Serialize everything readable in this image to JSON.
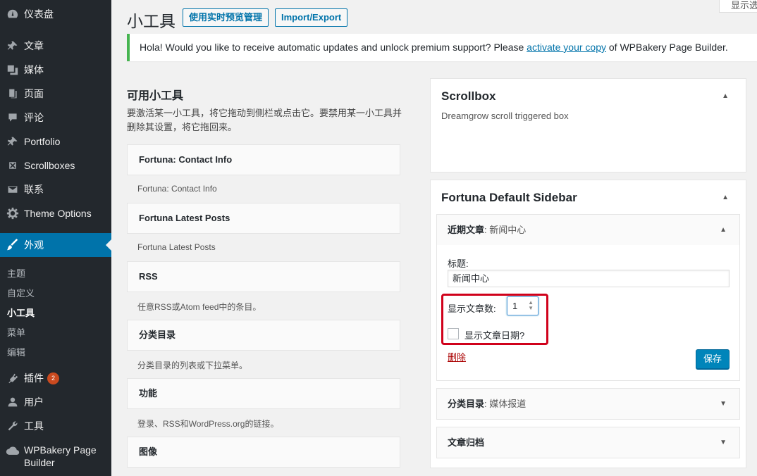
{
  "sidebar": {
    "items": [
      {
        "label": "仪表盘",
        "icon": "dashboard-icon"
      },
      {
        "label": "文章",
        "icon": "pin-icon"
      },
      {
        "label": "媒体",
        "icon": "media-icon"
      },
      {
        "label": "页面",
        "icon": "page-icon"
      },
      {
        "label": "评论",
        "icon": "comment-icon"
      },
      {
        "label": "Portfolio",
        "icon": "pin-icon"
      },
      {
        "label": "Scrollboxes",
        "icon": "box-icon"
      },
      {
        "label": "联系",
        "icon": "mail-icon"
      },
      {
        "label": "Theme Options",
        "icon": "gear-icon"
      },
      {
        "label": "外观",
        "icon": "brush-icon"
      }
    ],
    "submenu": [
      "主题",
      "自定义",
      "小工具",
      "菜单",
      "编辑"
    ],
    "bottom_items": [
      {
        "label": "插件",
        "icon": "plugin-icon",
        "badge": "2"
      },
      {
        "label": "用户",
        "icon": "user-icon"
      },
      {
        "label": "工具",
        "icon": "wrench-icon"
      },
      {
        "label": "WPBakery Page Builder",
        "icon": "cloud-icon"
      }
    ]
  },
  "header": {
    "title": "小工具",
    "live_preview_btn": "使用实时预览管理",
    "import_export_btn": "Import/Export",
    "screen_options": "显示选项"
  },
  "notice": {
    "text_before": "Hola! Would you like to receive automatic updates and unlock premium support? Please ",
    "link": "activate your copy",
    "text_after": " of WPBakery Page Builder."
  },
  "available": {
    "title": "可用小工具",
    "desc": "要激活某一小工具，将它拖动到侧栏或点击它。要禁用某一小工具并删除其设置，将它拖回来。",
    "widgets": [
      {
        "name": "Fortuna: Contact Info",
        "desc": "Fortuna: Contact Info"
      },
      {
        "name": "Fortuna Latest Posts",
        "desc": "Fortuna Latest Posts"
      },
      {
        "name": "RSS",
        "desc": "任意RSS或Atom feed中的条目。"
      },
      {
        "name": "分类目录",
        "desc": "分类目录的列表或下拉菜单。"
      },
      {
        "name": "功能",
        "desc": "登录、RSS和WordPress.org的链接。"
      },
      {
        "name": "图像",
        "desc": ""
      }
    ]
  },
  "sidebars": {
    "scrollbox": {
      "title": "Scrollbox",
      "desc": "Dreamgrow scroll triggered box"
    },
    "fortuna": {
      "title": "Fortuna Default Sidebar",
      "recent": {
        "head": "近期文章",
        "head_sub": "新闻中心",
        "title_label": "标题:",
        "title_value": "新闻中心",
        "count_label": "显示文章数:",
        "count_value": "1",
        "date_label": "显示文章日期?",
        "delete": "删除",
        "save": "保存"
      },
      "category": {
        "head": "分类目录",
        "head_sub": "媒体报道"
      },
      "archive": {
        "head": "文章归档"
      }
    }
  }
}
